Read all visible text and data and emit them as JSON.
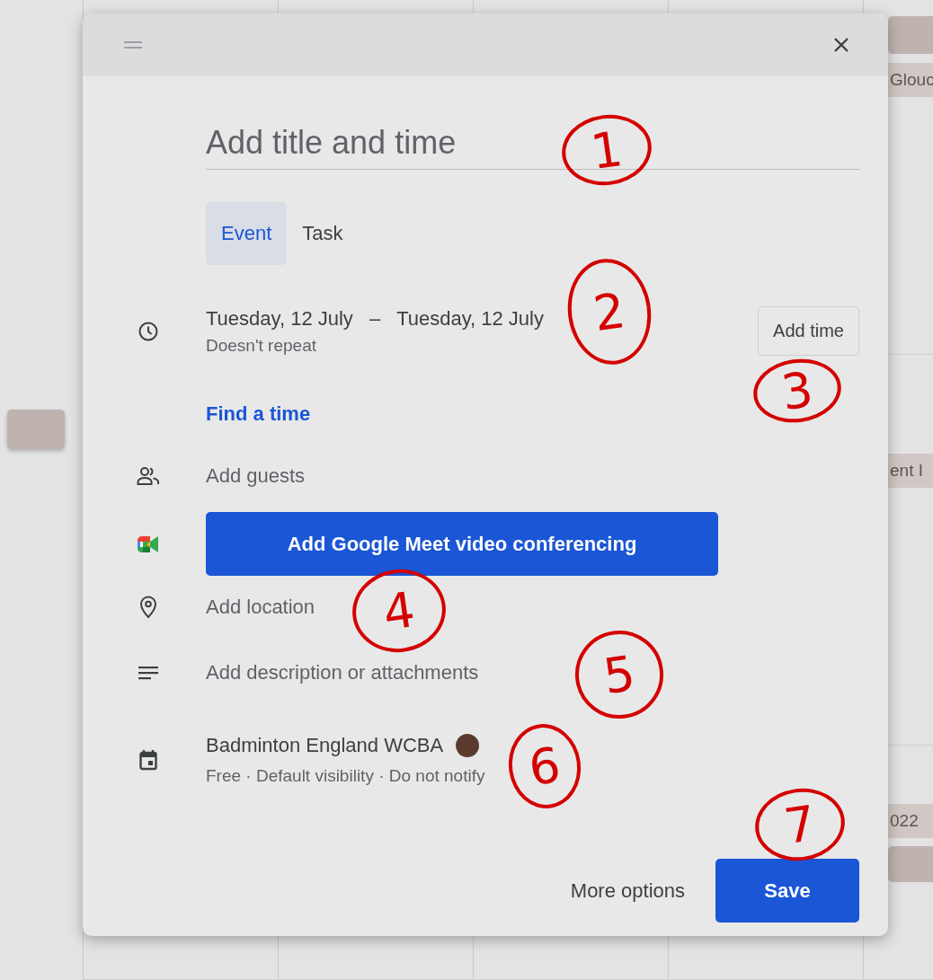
{
  "dialog": {
    "title_placeholder": "Add title and time",
    "tabs": [
      {
        "label": "Event",
        "selected": true
      },
      {
        "label": "Task",
        "selected": false
      }
    ],
    "date": {
      "start": "Tuesday, 12 July",
      "separator": "–",
      "end": "Tuesday, 12 July",
      "repeat": "Doesn't repeat"
    },
    "add_time_button": "Add time",
    "find_time_link": "Find a time",
    "guests_placeholder": "Add guests",
    "meet_button": "Add Google Meet video conferencing",
    "location_placeholder": "Add location",
    "description_placeholder": "Add description or attachments",
    "calendar": {
      "name": "Badminton England WCBA",
      "color": "#5b3a2e",
      "details": "Free · Default visibility · Do not notify"
    },
    "more_options_button": "More options",
    "save_button": "Save"
  },
  "background_events": [
    {
      "label": "Glouc"
    },
    {
      "label": "ent I"
    },
    {
      "label": "022"
    }
  ],
  "annotations": [
    {
      "label": "1"
    },
    {
      "label": "2"
    },
    {
      "label": "3"
    },
    {
      "label": "4"
    },
    {
      "label": "5"
    },
    {
      "label": "6"
    },
    {
      "label": "7"
    }
  ]
}
